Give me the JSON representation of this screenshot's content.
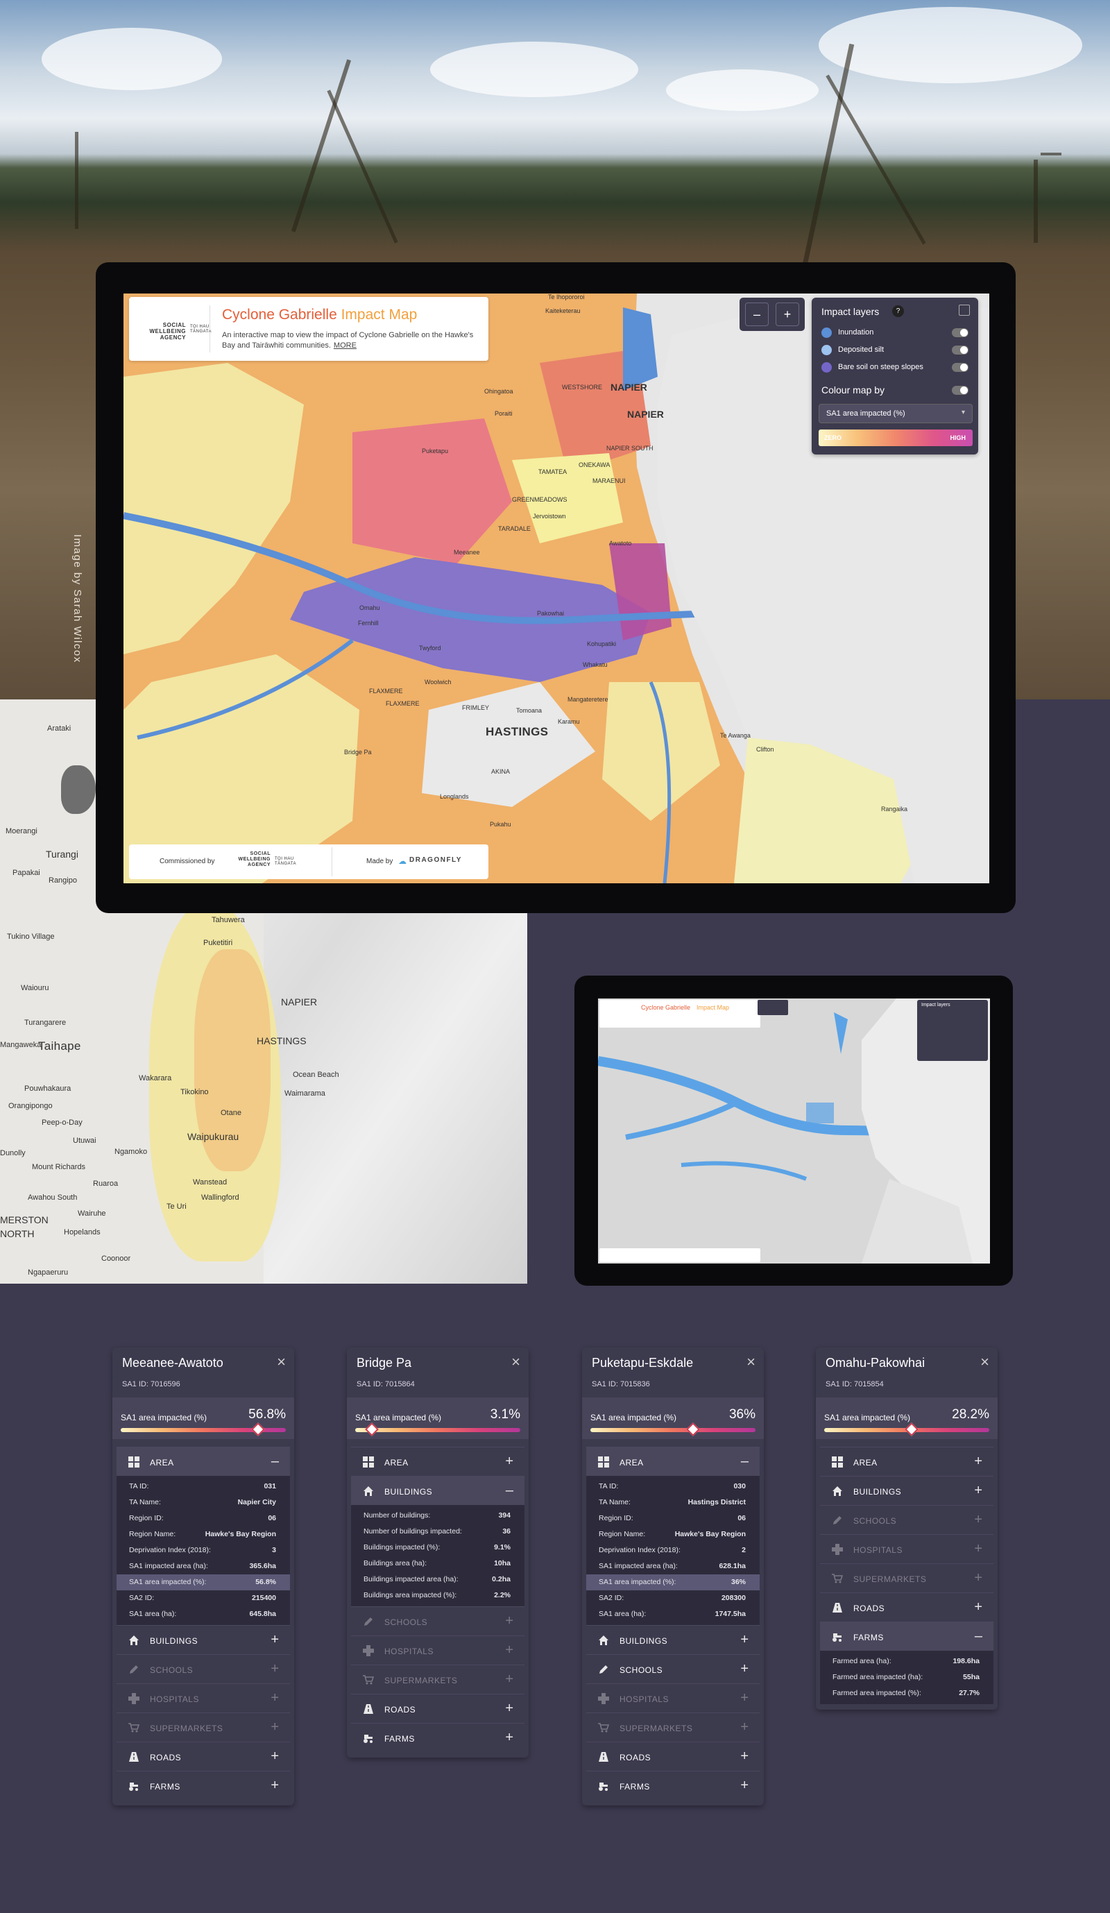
{
  "photo_credit": "Image by Sarah Wilcox",
  "map_title": {
    "main": "Cyclone Gabrielle",
    "accent": "Impact Map"
  },
  "map_description": "An interactive map to view the impact of Cyclone Gabrielle on the Hawke's Bay and Tairāwhiti communities.",
  "more_link": "MORE",
  "logo": {
    "line1": "SOCIAL",
    "line2": "WELLBEING",
    "line3": "AGENCY",
    "maori1": "TOI HAU",
    "maori2": "TĀNGATA"
  },
  "zoom": {
    "minus": "–",
    "plus": "+"
  },
  "impact_panel": {
    "title": "Impact layers",
    "help": "?",
    "layers": [
      {
        "label": "Inundation",
        "color": "#5b8fd6"
      },
      {
        "label": "Deposited silt",
        "color": "#9dc3ef"
      },
      {
        "label": "Bare soil on steep slopes",
        "color": "#7466c9"
      }
    ],
    "colour_map_label": "Colour map by",
    "colour_map_value": "SA1 area impacted (%)",
    "ramp_low": "ZERO",
    "ramp_high": "HIGH"
  },
  "footer": {
    "commissioned": "Commissioned by",
    "made": "Made by",
    "maker": "DRAGONFLY"
  },
  "main_map_places": [
    "Te Ihopororoi",
    "Kaiteketerau",
    "WESTSHORE",
    "NAPIER",
    "NAPIER",
    "Ohingatoa",
    "Poraiti",
    "Puketapu",
    "NAPIER SOUTH",
    "TAMATEA",
    "ONEKAWA",
    "MARAENUI",
    "GREENMEADOWS",
    "Jervoistown",
    "TARADALE",
    "Meeanee",
    "Awatoto",
    "Omahu",
    "Fernhill",
    "Pakowhai",
    "Twyford",
    "Kohupatiki",
    "Whakatu",
    "Woolwich",
    "FLAXMERE",
    "FLAXMERE",
    "FRIMLEY",
    "Tomoana",
    "Mangateretere",
    "Karamu",
    "HASTINGS",
    "Te Awanga",
    "Clifton",
    "Bridge Pa",
    "AKINA",
    "Longlands",
    "Rangaika",
    "Pukahu"
  ],
  "region_map_places": [
    "Arataki",
    "Moerangi",
    "Papakai",
    "Turangi",
    "Rangipo",
    "Tukino Village",
    "Taihape",
    "Waiouru",
    "Turangarere",
    "Pouwhakaura",
    "Tahuwera",
    "Puketitiri",
    "NAPIER",
    "HASTINGS",
    "Ocean Beach",
    "Waimarama",
    "Wakarara",
    "Tikokino",
    "Otane",
    "Waipukurau",
    "Ngamoko",
    "Utuwai",
    "Peep-o-Day",
    "Mount Richards",
    "Awahou South",
    "Ruaroa",
    "Te Uri",
    "Wallingford",
    "Wanstead",
    "Hopelands",
    "Coonoor",
    "Ngapaeruru",
    "MERSTON",
    "NORTH",
    "Orangipongo",
    "Dunolly",
    "Mangaweka",
    "Wairuhe"
  ],
  "tablet": {
    "title_main": "Cyclone Gabrielle",
    "title_accent": "Impact Map",
    "panel_title": "Impact layers"
  },
  "cards": [
    {
      "title": "Meeanee-Awatoto",
      "id": "SA1 ID: 7016596",
      "metric_label": "SA1 area impacted (%)",
      "metric_value": "56.8%",
      "metric_pct": 0.83,
      "sections": [
        {
          "label": "AREA",
          "icon": "grid-icon",
          "state": "open",
          "rows": [
            {
              "k": "TA ID:",
              "v": "031"
            },
            {
              "k": "TA Name:",
              "v": "Napier City"
            },
            {
              "k": "Region ID:",
              "v": "06"
            },
            {
              "k": "Region Name:",
              "v": "Hawke's Bay Region"
            },
            {
              "k": "Deprivation Index (2018):",
              "v": "3"
            },
            {
              "k": "SA1 impacted area (ha):",
              "v": "365.6ha"
            },
            {
              "k": "SA1 area impacted (%):",
              "v": "56.8%",
              "hl": true
            },
            {
              "k": "SA2 ID:",
              "v": "215400"
            },
            {
              "k": "SA1 area (ha):",
              "v": "645.8ha"
            }
          ]
        },
        {
          "label": "BUILDINGS",
          "icon": "house-icon",
          "state": "closed"
        },
        {
          "label": "SCHOOLS",
          "icon": "pencil-icon",
          "state": "dim"
        },
        {
          "label": "HOSPITALS",
          "icon": "cross-icon",
          "state": "dim"
        },
        {
          "label": "SUPERMARKETS",
          "icon": "cart-icon",
          "state": "dim"
        },
        {
          "label": "ROADS",
          "icon": "road-icon",
          "state": "closed"
        },
        {
          "label": "FARMS",
          "icon": "tractor-icon",
          "state": "closed"
        }
      ]
    },
    {
      "title": "Bridge Pa",
      "id": "SA1 ID: 7015864",
      "metric_label": "SA1 area impacted (%)",
      "metric_value": "3.1%",
      "metric_pct": 0.1,
      "sections": [
        {
          "label": "AREA",
          "icon": "grid-icon",
          "state": "closed"
        },
        {
          "label": "BUILDINGS",
          "icon": "house-icon",
          "state": "open",
          "rows": [
            {
              "k": "Number of buildings:",
              "v": "394"
            },
            {
              "k": "Number of buildings impacted:",
              "v": "36"
            },
            {
              "k": "Buildings impacted (%):",
              "v": "9.1%"
            },
            {
              "k": "Buildings area (ha):",
              "v": "10ha"
            },
            {
              "k": "Buildings impacted area (ha):",
              "v": "0.2ha"
            },
            {
              "k": "Buildings area impacted (%):",
              "v": "2.2%"
            }
          ]
        },
        {
          "label": "SCHOOLS",
          "icon": "pencil-icon",
          "state": "dim"
        },
        {
          "label": "HOSPITALS",
          "icon": "cross-icon",
          "state": "dim"
        },
        {
          "label": "SUPERMARKETS",
          "icon": "cart-icon",
          "state": "dim"
        },
        {
          "label": "ROADS",
          "icon": "road-icon",
          "state": "closed"
        },
        {
          "label": "FARMS",
          "icon": "tractor-icon",
          "state": "closed"
        }
      ]
    },
    {
      "title": "Puketapu-Eskdale",
      "id": "SA1 ID: 7015836",
      "metric_label": "SA1 area impacted (%)",
      "metric_value": "36%",
      "metric_pct": 0.62,
      "sections": [
        {
          "label": "AREA",
          "icon": "grid-icon",
          "state": "open",
          "rows": [
            {
              "k": "TA ID:",
              "v": "030"
            },
            {
              "k": "TA Name:",
              "v": "Hastings District"
            },
            {
              "k": "Region ID:",
              "v": "06"
            },
            {
              "k": "Region Name:",
              "v": "Hawke's Bay Region"
            },
            {
              "k": "Deprivation Index (2018):",
              "v": "2"
            },
            {
              "k": "SA1 impacted area (ha):",
              "v": "628.1ha"
            },
            {
              "k": "SA1 area impacted (%):",
              "v": "36%",
              "hl": true
            },
            {
              "k": "SA2 ID:",
              "v": "208300"
            },
            {
              "k": "SA1 area (ha):",
              "v": "1747.5ha"
            }
          ]
        },
        {
          "label": "BUILDINGS",
          "icon": "house-icon",
          "state": "closed"
        },
        {
          "label": "SCHOOLS",
          "icon": "pencil-icon",
          "state": "closed"
        },
        {
          "label": "HOSPITALS",
          "icon": "cross-icon",
          "state": "dim"
        },
        {
          "label": "SUPERMARKETS",
          "icon": "cart-icon",
          "state": "dim"
        },
        {
          "label": "ROADS",
          "icon": "road-icon",
          "state": "closed"
        },
        {
          "label": "FARMS",
          "icon": "tractor-icon",
          "state": "closed"
        }
      ]
    },
    {
      "title": "Omahu-Pakowhai",
      "id": "SA1 ID: 7015854",
      "metric_label": "SA1 area impacted (%)",
      "metric_value": "28.2%",
      "metric_pct": 0.53,
      "sections": [
        {
          "label": "AREA",
          "icon": "grid-icon",
          "state": "closed"
        },
        {
          "label": "BUILDINGS",
          "icon": "house-icon",
          "state": "closed"
        },
        {
          "label": "SCHOOLS",
          "icon": "pencil-icon",
          "state": "dim"
        },
        {
          "label": "HOSPITALS",
          "icon": "cross-icon",
          "state": "dim"
        },
        {
          "label": "SUPERMARKETS",
          "icon": "cart-icon",
          "state": "dim"
        },
        {
          "label": "ROADS",
          "icon": "road-icon",
          "state": "closed"
        },
        {
          "label": "FARMS",
          "icon": "tractor-icon",
          "state": "open",
          "rows": [
            {
              "k": "Farmed area (ha):",
              "v": "198.6ha"
            },
            {
              "k": "Farmed area impacted (ha):",
              "v": "55ha"
            },
            {
              "k": "Farmed area impacted (%):",
              "v": "27.7%"
            }
          ]
        }
      ]
    }
  ]
}
